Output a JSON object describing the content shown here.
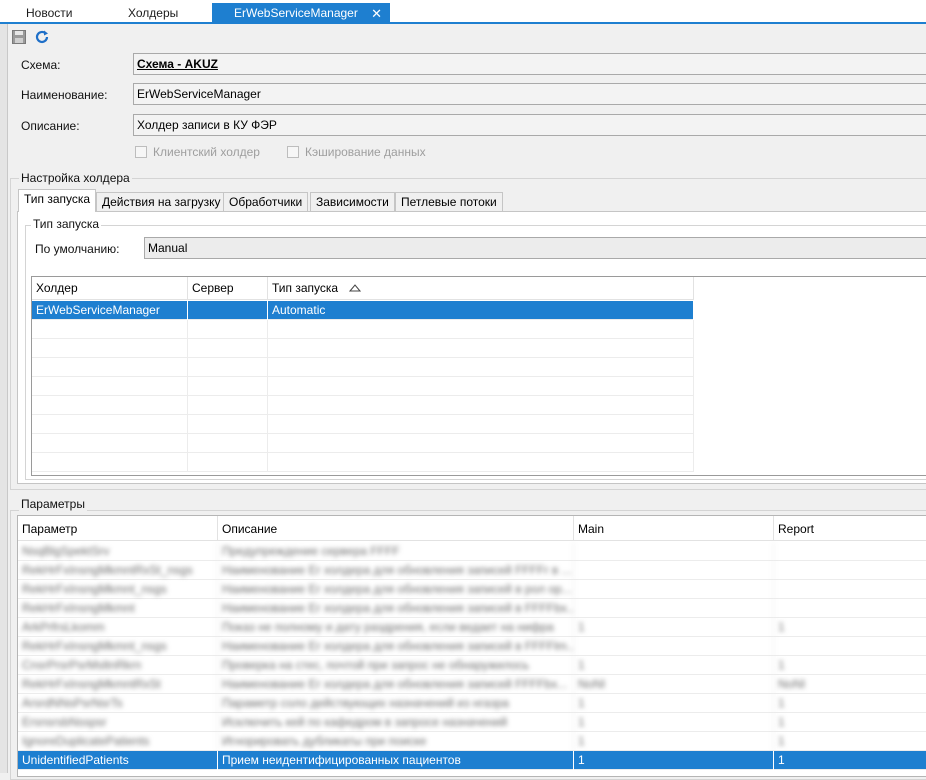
{
  "tabs": [
    {
      "label": "Новости",
      "active": false
    },
    {
      "label": "Холдеры",
      "active": false
    },
    {
      "label": "ErWebServiceManager",
      "active": true
    }
  ],
  "tab_close_glyph": "✕",
  "toolbar": {
    "save_icon": "save-icon",
    "refresh_icon": "refresh-icon"
  },
  "form": {
    "schema_label": "Схема:",
    "schema_value": "Схема - AKUZ",
    "name_label": "Наименование:",
    "name_value": "ErWebServiceManager",
    "description_label": "Описание:",
    "description_value": "Холдер записи в КУ ФЭР",
    "client_holder_label": "Клиентский холдер",
    "cache_label": "Кэширование данных"
  },
  "holder_settings": {
    "title": "Настройка холдера",
    "tabs": [
      "Тип запуска",
      "Действия на загрузку",
      "Обработчики",
      "Зависимости",
      "Петлевые потоки"
    ],
    "launch_group_title": "Тип запуска",
    "default_label": "По умолчанию:",
    "default_value": "Manual",
    "grid": {
      "columns": [
        "Холдер",
        "Сервер",
        "Тип запуска"
      ],
      "rows": [
        {
          "holder": "ErWebServiceManager",
          "server": "",
          "launch": "Automatic",
          "selected": true
        }
      ]
    }
  },
  "params": {
    "title": "Параметры",
    "columns": [
      "Параметр",
      "Описание",
      "Main",
      "Report"
    ],
    "rows": [
      {
        "name": "NsqBlgSpektSrv",
        "desc": "Предупреждение сервера FFFF",
        "main": "",
        "report": "",
        "blurred": true
      },
      {
        "name": "RekHrFxInsngMkmntRxSt_nsgs",
        "desc": "Наименование Er холдера для обновления записей FFFFr в ...",
        "main": "",
        "report": "",
        "blurred": true
      },
      {
        "name": "RekHrFxInsngMkmnt_nsgs",
        "desc": "Наименование Er холдера для обновления записей в рол ор...",
        "main": "",
        "report": "",
        "blurred": true
      },
      {
        "name": "RekHrFxInsngMkmnt",
        "desc": "Наименование Er холдера для обновления записей в FFFFbx...",
        "main": "",
        "report": "",
        "blurred": true
      },
      {
        "name": "ArkPrfrsLkomm",
        "desc": "Показ не полному и дату раздрения, если ведает на нифра",
        "main": "1",
        "report": "1",
        "blurred": true
      },
      {
        "name": "RekHrFxInsngMkmnt_nsgs",
        "desc": "Наименование Er холдера для обновления записей в FFFFlm...",
        "main": "",
        "report": "",
        "blurred": true
      },
      {
        "name": "CnsrPrsrPsrMsltnRkrn",
        "desc": "Проверка на стес, почтой при запрос не обнаружилось",
        "main": "1",
        "report": "1",
        "blurred": true
      },
      {
        "name": "RekHrFxInsngMkmntRxSt",
        "desc": "Наименование Er холдера для обновления записей FFFFbx...",
        "main": "NoNI",
        "report": "NoNI",
        "blurred": true
      },
      {
        "name": "ArsrdNNsPsrNsrTs",
        "desc": "Параметр соло действующих назначений из нгазра",
        "main": "1",
        "report": "1",
        "blurred": true
      },
      {
        "name": "ErsnsrsbNsspsr",
        "desc": "Исключить кей по кафедром в запросе назначений",
        "main": "1",
        "report": "1",
        "blurred": true
      },
      {
        "name": "IgnoreDuplicatePatients",
        "desc": "Игнорировать дубликаты при поиске",
        "main": "1",
        "report": "1",
        "blurred": true
      },
      {
        "name": "UnidentifiedPatients",
        "desc": "Прием неидентифицированных пациентов",
        "main": "1",
        "report": "1",
        "blurred": false,
        "selected": true
      }
    ]
  },
  "colors": {
    "accent": "#1e7fd0",
    "refresh": "#1e6fc8"
  }
}
